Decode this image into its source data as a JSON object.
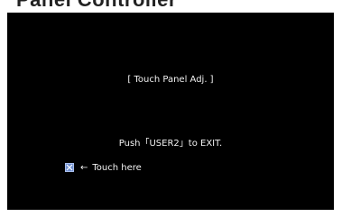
{
  "header": {
    "clipped_heading": "Panel Controller"
  },
  "screen": {
    "title": "[ Touch Panel Adj. ]",
    "exit_instruction": "Push「USER2」to EXIT.",
    "touch_arrow": "←",
    "touch_label": "Touch here",
    "touch_target_icon": "x-box-icon"
  },
  "colors": {
    "screen_background": "#000000",
    "text": "#f2f2f2",
    "touch_target_fill": "#6f8fcf"
  }
}
